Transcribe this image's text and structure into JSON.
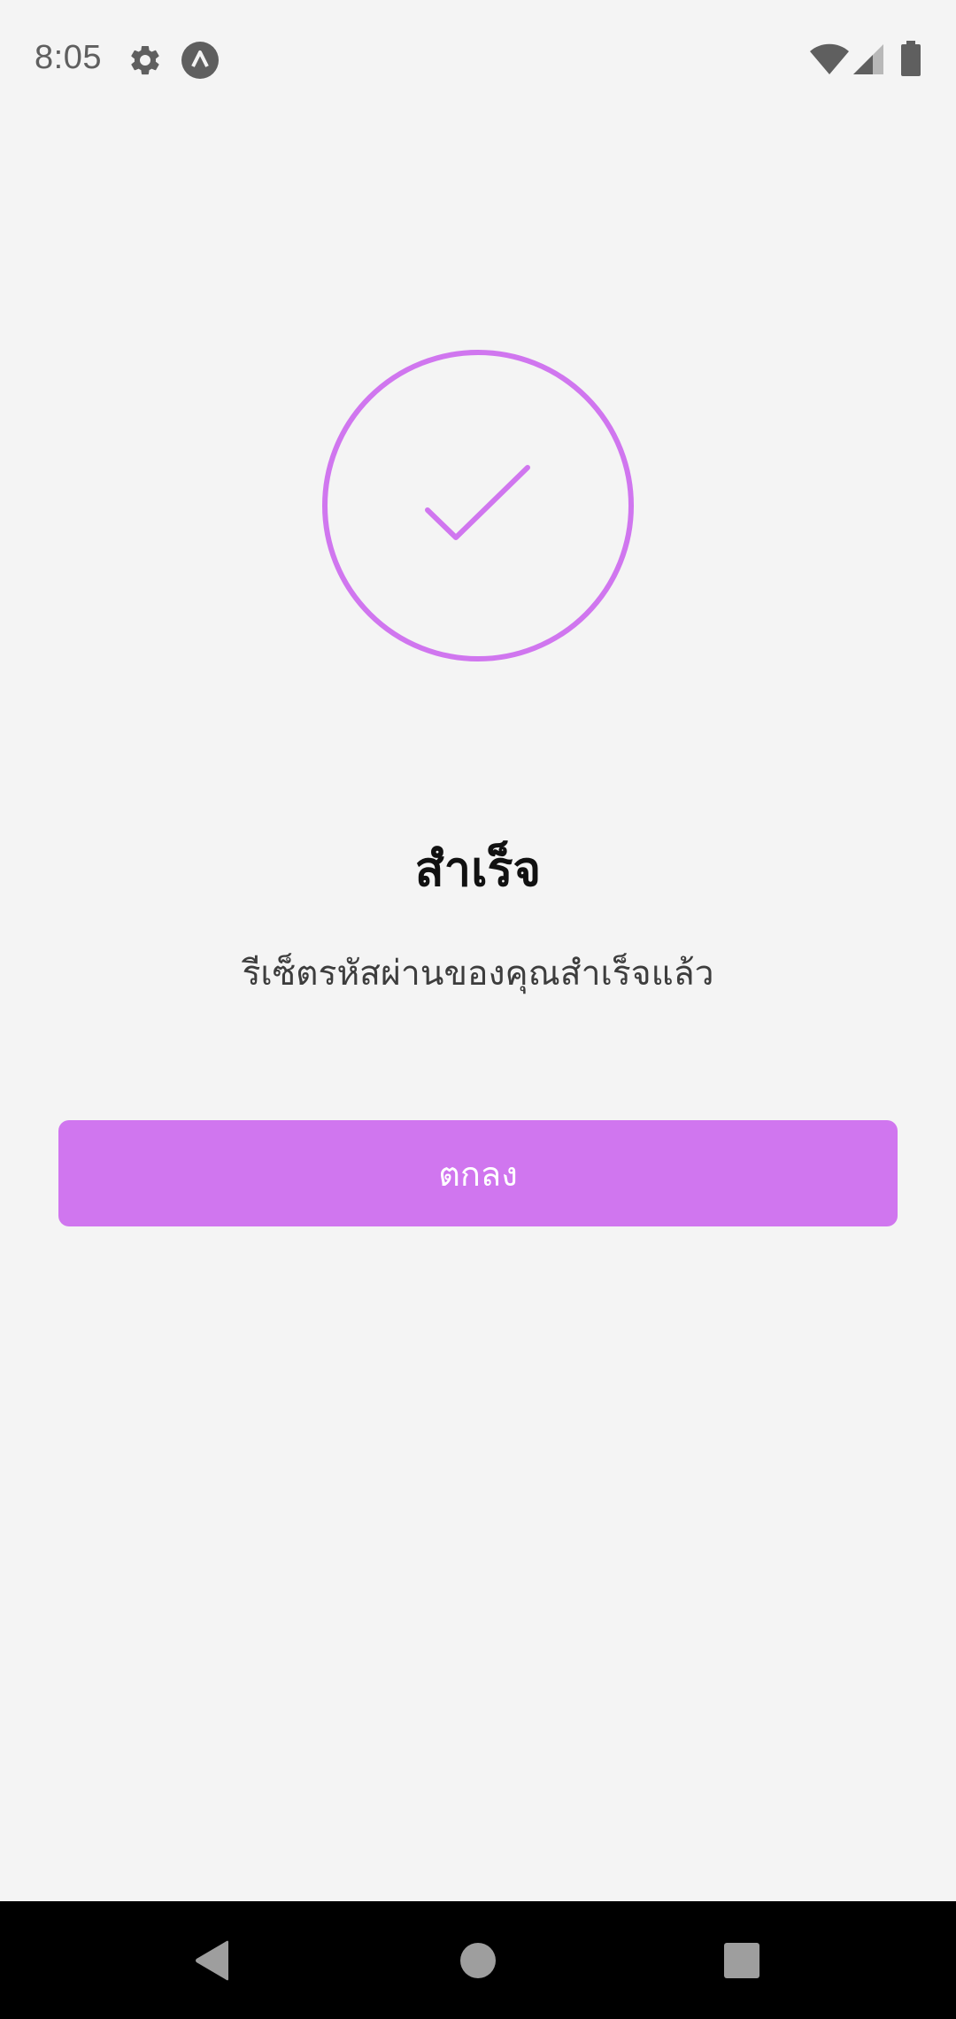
{
  "status_bar": {
    "time": "8:05",
    "icons": [
      "gear-icon",
      "app-notification-icon",
      "wifi-icon",
      "signal-icon",
      "battery-icon"
    ]
  },
  "success": {
    "icon": "check-circle-icon",
    "title": "สำเร็จ",
    "message": "รีเซ็ตรหัสผ่านของคุณสำเร็จแล้ว"
  },
  "actions": {
    "ok_label": "ตกลง"
  },
  "nav_bar": {
    "icons": [
      "back-icon",
      "home-icon",
      "recents-icon"
    ]
  },
  "colors": {
    "accent": "#d076ef",
    "background": "#f4f4f4",
    "title": "#111111",
    "message": "#3d3d3d"
  }
}
